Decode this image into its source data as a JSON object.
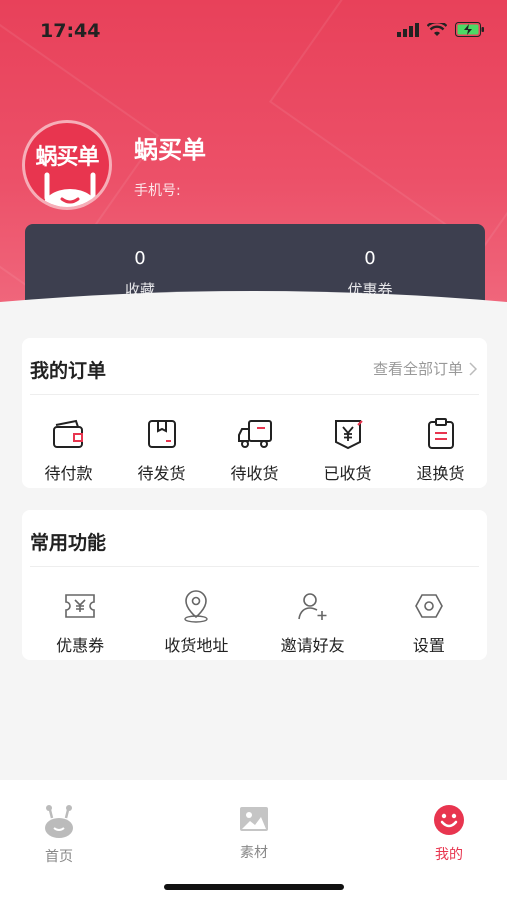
{
  "status_bar": {
    "time": "17:44"
  },
  "profile": {
    "avatar_brand": "蜗买单",
    "username": "蜗买单",
    "phone_label": "手机号:"
  },
  "stats": [
    {
      "value": "0",
      "label": "收藏"
    },
    {
      "value": "0",
      "label": "优惠券"
    }
  ],
  "orders": {
    "title": "我的订单",
    "view_all": "查看全部订单",
    "items": [
      {
        "label": "待付款",
        "icon": "wallet-icon"
      },
      {
        "label": "待发货",
        "icon": "package-icon"
      },
      {
        "label": "待收货",
        "icon": "truck-icon"
      },
      {
        "label": "已收货",
        "icon": "received-yen-icon"
      },
      {
        "label": "退换货",
        "icon": "clipboard-icon"
      }
    ]
  },
  "functions": {
    "title": "常用功能",
    "items": [
      {
        "label": "优惠券",
        "icon": "coupon-icon"
      },
      {
        "label": "收货地址",
        "icon": "location-icon"
      },
      {
        "label": "邀请好友",
        "icon": "add-user-icon"
      },
      {
        "label": "设置",
        "icon": "hexagon-settings-icon"
      }
    ]
  },
  "tabbar": {
    "active": "我的",
    "items": [
      {
        "label": "首页",
        "icon": "snail-home-icon"
      },
      {
        "label": "素材",
        "icon": "image-icon"
      },
      {
        "label": "我的",
        "icon": "smiley-icon"
      }
    ]
  },
  "colors": {
    "accent": "#e8354f",
    "stats_bg": "#3d3f4f",
    "page_bg": "#f5f5f5"
  }
}
